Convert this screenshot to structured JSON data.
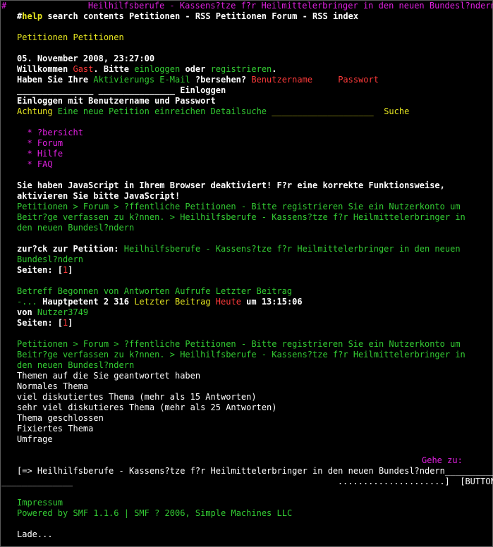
{
  "header": {
    "hash": "#",
    "title": "Heilhilfsberufe - Kassens?tze f?r Heilmittelerbringer in den neuen Bundesl?ndern",
    "nav_hash": "#",
    "nav_help": "help",
    "nav_rest": " search contents Petitionen - RSS Petitionen Forum - RSS index"
  },
  "petitionen": {
    "link": "Petitionen",
    "text": " Petitionen"
  },
  "login": {
    "date": "05. November 2008, 23:27:00",
    "welcome": "Willkommen ",
    "guest": "Gast",
    "please": ". Bitte ",
    "login_link": "einloggen",
    "or": " oder ",
    "register_link": "registrieren",
    "dot": ".",
    "missed_a": "Haben Sie Ihre ",
    "activation_link": "Aktivierungs E-Mail",
    "missed_b": " ?bersehen? ",
    "username_label": "Benutzername",
    "password_label": "Passwort",
    "fields_line": "_______________ _______________ ",
    "login_button": "Einloggen",
    "login_with": "Einloggen mit Benutzername und Passwort",
    "attention": "Achtung",
    "new_petition": " Eine neue Petition einreichen Detailsuche ",
    "search_field": "____________________",
    "search_button": "Suche"
  },
  "menu": {
    "bullet": "*",
    "items": [
      "?bersicht",
      "Forum",
      "Hilfe",
      "FAQ"
    ]
  },
  "notice": {
    "line1": "Sie haben JavaScript in Ihrem Browser deaktiviert! F?r eine korrekte Funktionsweise,",
    "line2": "aktivieren Sie bitte JavaScript!"
  },
  "breadcrumb1": {
    "line1": "Petitionen > Forum > ?ffentliche Petitionen - Bitte registrieren Sie ein Nutzerkonto um",
    "line2": "Beitr?ge verfassen zu k?nnen. > Heilhilfsberufe - Kassens?tze f?r Heilmittelerbringer in",
    "line3": "den neuen Bundesl?ndern"
  },
  "back": {
    "label": "zur?ck zur Petition: ",
    "link1": "Heilhilfsberufe - Kassens?tze f?r Heilmittelerbringer in den neuen",
    "link2": "Bundesl?ndern"
  },
  "pages1": {
    "label": "Seiten: [",
    "page": "1",
    "close": "]"
  },
  "topics": {
    "header": "Betreff Begonnen von Antworten Aufrufe Letzter Beitrag",
    "dash": "-...",
    "topic": " Hauptpetent",
    "counts": " 2 316 ",
    "last_post": "Letzter Beitrag",
    "today": "Heute",
    "time": " um 13:15:06",
    "by": "von ",
    "author": "Nutzer3749"
  },
  "pages2": {
    "label": "Seiten: [",
    "page": "1",
    "close": "]"
  },
  "breadcrumb2": {
    "line1": "Petitionen > Forum > ?ffentliche Petitionen - Bitte registrieren Sie ein Nutzerkonto um",
    "line2": "Beitr?ge verfassen zu k?nnen. > Heilhilfsberufe - Kassens?tze f?r Heilmittelerbringer in",
    "line3": "den neuen Bundesl?ndern"
  },
  "legend": [
    "Themen auf die Sie geantwortet haben",
    "Normales Thema",
    "viel diskutiertes Thema (mehr als 15 Antworten)",
    "sehr viel diskutieres Thema (mehr als 25 Antworten)",
    "Thema geschlossen",
    "Fixiertes Thema",
    "Umfrage"
  ],
  "jump": {
    "label": "Gehe zu:",
    "select_line1": "[=> Heilhilfsberufe - Kassens?tze f?r Heilmittelerbringer in den neuen Bundesl?ndern_____________",
    "select_line2": "______________                                                    .....................]",
    "button": "[BUTTON]"
  },
  "footer": {
    "impressum": "Impressum",
    "powered_a": "Powered by ",
    "smf_link": "SMF 1.1.6",
    "sep": " | ",
    "copyright_link": "SMF ? 2006, Simple Machines LLC",
    "loading": "Lade..."
  },
  "colors": {
    "background": "#000000",
    "link_green": "#33cc33",
    "magenta": "#e020e0",
    "yellow": "#e6e620",
    "red": "#ff3a3a"
  }
}
